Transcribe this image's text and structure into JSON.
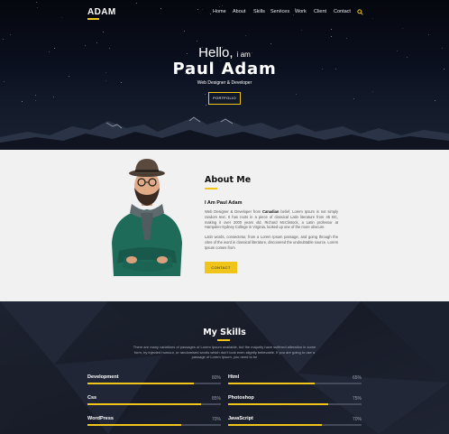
{
  "brand": {
    "logo": "ADAM",
    "accent": "#f0c419"
  },
  "nav": {
    "items": [
      "Home",
      "About",
      "Skills",
      "Services",
      "Work",
      "Client",
      "Contact"
    ],
    "search_icon": "search-icon"
  },
  "hero": {
    "hello": "Hello,",
    "iam": "i am",
    "name": "Paul Adam",
    "role": "Web Designer & Developer",
    "button": "PORTFOLIO"
  },
  "about": {
    "title": "About Me",
    "subtitle": "I Am Paul Adam",
    "p1_before": "Web Designer & Developer from ",
    "p1_bold": "Canadian",
    "p1_after": " belief, Lorem Ipsum is not simply random text. It has roots in a piece of classical Latin literature from 45 BC, making it over 2000 years old. Richard McClintock, a Latin professor at Hampden-Sydney College in Virginia, looked up one of the more obscure.",
    "p2": "Latin words, consectetur, from a Lorem Ipsum passage, and going through the cites of the word in classical literature, discovered the undoubtable source. Lorem Ipsum comes from",
    "button": "CONTACT"
  },
  "skills": {
    "title": "My Skills",
    "description": "There are many variations of passages of Lorem Ipsum available, but the majority have suffered alteration in some form, by injected humour, or randomised words which don't look even slightly believable. If you are going to use a passage of Lorem Ipsum, you need to be",
    "items": [
      {
        "name": "Development",
        "percent": "80%",
        "value": 0.8
      },
      {
        "name": "Html",
        "percent": "65%",
        "value": 0.65
      },
      {
        "name": "Css",
        "percent": "85%",
        "value": 0.85
      },
      {
        "name": "Photoshop",
        "percent": "75%",
        "value": 0.75
      },
      {
        "name": "WordPress",
        "percent": "70%",
        "value": 0.7
      },
      {
        "name": "JavaScript",
        "percent": "70%",
        "value": 0.7
      }
    ]
  }
}
